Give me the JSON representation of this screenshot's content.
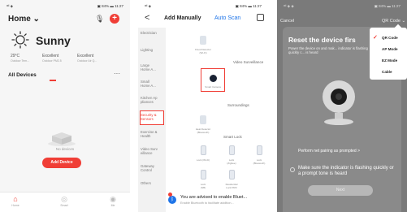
{
  "colors": {
    "accent_red": "#f03e36",
    "accent_blue": "#1e74e8"
  },
  "screen1": {
    "status_left": "ᵃᵗˡ ◈",
    "status_right": "▣ 84% ▬ 11:27",
    "home_label": "Home ⌄",
    "weather": "Sunny",
    "stats": [
      {
        "value": "29°C",
        "label": "Outdoor Tem..."
      },
      {
        "value": "Excellent",
        "label": "Outdoor PM2.5"
      },
      {
        "value": "Excellent",
        "label": "Outdoor Air Q..."
      }
    ],
    "all_devices": "All Devices",
    "more": "···",
    "no_devices": "No devices",
    "add_device": "Add Device",
    "nav": [
      "Home",
      "Smart",
      "Me"
    ]
  },
  "screen2": {
    "status_left": "ᵃᵗˡ ◈",
    "status_right": "▣ 84% ▬ 11:27",
    "back": "<",
    "title": "Add Manually",
    "auto_scan": "Auto Scan",
    "categories": [
      "Electrician",
      "Lighting",
      "Large\nHome A...",
      "Small\nHome A...",
      "Kitchen Ap\npliances",
      "Security &\nSensors",
      "Exercise &\nHealth",
      "Video Surv\neillance",
      "Gateway\nControl",
      "Others"
    ],
    "sections": [
      "Video Surveillance",
      "Surroundings",
      "Smart Lock"
    ],
    "devices": {
      "flood": "Flood Detector\n(Wi-Fi)",
      "smart_camera": "Smart Camera",
      "heat": "Heat Detector\n(Bluetooth)",
      "lock_wifi": "Lock (Wi-Fi)",
      "lock_zigbee": "Lock\n(Zigbee)",
      "lock_bt": "Lock\n(Bluetooth)",
      "lock_nb": "Lock\n(NB)",
      "residential": "Residential\nLock PRO"
    },
    "banner_main": "You are advised to enable Bluet...",
    "banner_sub": "Enable Bluetooth to facilitate addition..."
  },
  "screen3": {
    "status_left": "ᵃᵗˡ ◈ ◈",
    "status_right": "▣ 84% ▬ 11:27",
    "cancel": "Cancel",
    "qr_top": "QR Code ⌄",
    "title": "Reset the device firs",
    "desc": "Power the device on and mak... indicator is flashing quickly c... is heard",
    "perform": "Perform net pairing as prompted >",
    "make_sure": "Make sure the indicator is flashing quickly or a prompt tone is heard",
    "next": "Next",
    "menu": [
      {
        "label": "QR Code",
        "checked": true
      },
      {
        "label": "AP Mode",
        "checked": false
      },
      {
        "label": "EZ Mode",
        "checked": false
      },
      {
        "label": "Cable",
        "checked": false
      }
    ]
  }
}
